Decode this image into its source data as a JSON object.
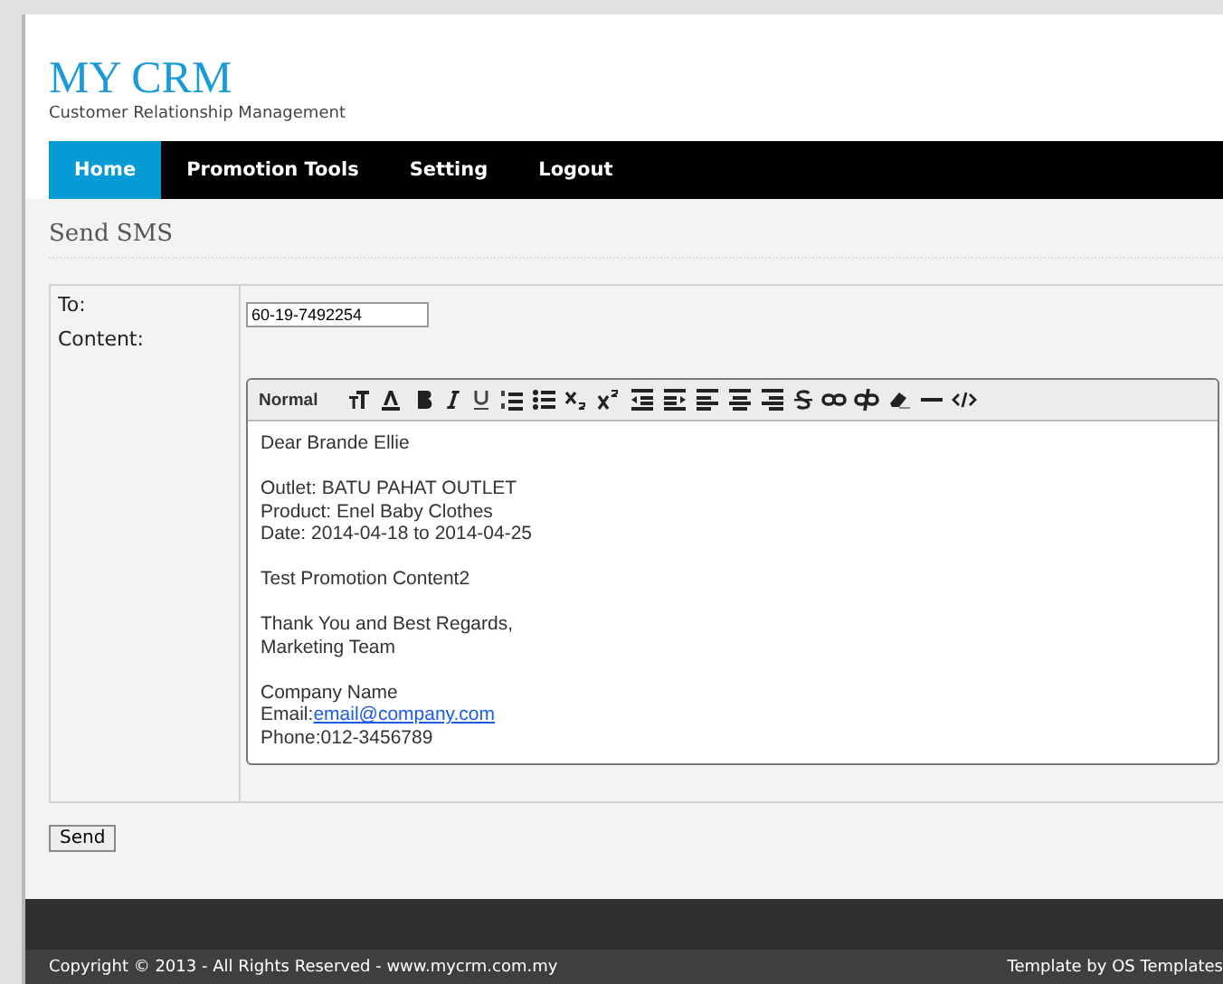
{
  "header": {
    "title": "MY CRM",
    "subtitle": "Customer Relationship Management"
  },
  "nav": [
    {
      "label": "Home",
      "selected": true
    },
    {
      "label": "Promotion Tools",
      "selected": false
    },
    {
      "label": "Setting",
      "selected": false
    },
    {
      "label": "Logout",
      "selected": false
    }
  ],
  "page_title": "Send SMS",
  "form": {
    "to_label": "To:",
    "to_value": "60-19-7492254",
    "content_label": "Content:"
  },
  "editor": {
    "format": "Normal",
    "tools": [
      {
        "kind": "font-size"
      },
      {
        "kind": "color"
      },
      {
        "kind": "bold"
      },
      {
        "kind": "italic"
      },
      {
        "kind": "underline"
      },
      {
        "kind": "ordered-list"
      },
      {
        "kind": "bullet-list"
      },
      {
        "kind": "subscript"
      },
      {
        "kind": "superscript"
      },
      {
        "kind": "outdent"
      },
      {
        "kind": "indent"
      },
      {
        "kind": "align-left"
      },
      {
        "kind": "align-center"
      },
      {
        "kind": "align-right"
      },
      {
        "kind": "strikethrough"
      },
      {
        "kind": "link"
      },
      {
        "kind": "unlink"
      },
      {
        "kind": "eraser"
      },
      {
        "kind": "rule"
      },
      {
        "kind": "code"
      }
    ],
    "paragraphs": [
      [
        {
          "text": "Dear Brande Ellie"
        }
      ],
      [
        {
          "text": "Outlet: BATU PAHAT OUTLET"
        },
        {
          "text": "Product: Enel Baby Clothes"
        },
        {
          "text": "Date: 2014-04-18 to 2014-04-25"
        }
      ],
      [
        {
          "text": "Test Promotion Content2"
        }
      ],
      [
        {
          "text": "Thank You and Best Regards,"
        },
        {
          "text": "Marketing Team"
        }
      ],
      [
        {
          "text": "Company Name"
        },
        {
          "text": "Email:",
          "link": "email@company.com"
        },
        {
          "text": "Phone:012-3456789"
        }
      ]
    ]
  },
  "send_button": "Send",
  "footer": {
    "copyright": "Copyright © 2013 - All Rights Reserved - www.mycrm.com.my",
    "credit": "Template by OS Templates"
  }
}
